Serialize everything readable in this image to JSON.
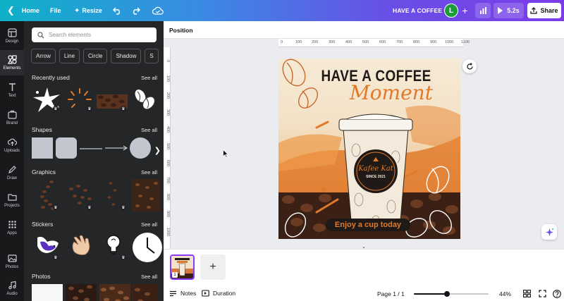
{
  "topbar": {
    "home_label": "Home",
    "file_label": "File",
    "resize_label": "Resize",
    "doc_title": "HAVE A COFFEE",
    "avatar_initial": "L",
    "play_label": "5.2s",
    "share_label": "Share"
  },
  "rail": {
    "items": [
      {
        "label": "Design",
        "icon": "design-icon"
      },
      {
        "label": "Elements",
        "icon": "elements-icon"
      },
      {
        "label": "Text",
        "icon": "text-icon"
      },
      {
        "label": "Brand",
        "icon": "brand-icon"
      },
      {
        "label": "Uploads",
        "icon": "upload-icon"
      },
      {
        "label": "Draw",
        "icon": "draw-icon"
      },
      {
        "label": "Projects",
        "icon": "folder-icon"
      },
      {
        "label": "Apps",
        "icon": "apps-icon"
      },
      {
        "label": "Photos",
        "icon": "photos-icon"
      },
      {
        "label": "Audio",
        "icon": "audio-icon"
      }
    ]
  },
  "panel": {
    "search_placeholder": "Search elements",
    "chips": [
      "Arrow",
      "Line",
      "Circle",
      "Shadow",
      "S"
    ],
    "see_all": "See all",
    "sections": {
      "recent": "Recently used",
      "shapes": "Shapes",
      "graphics": "Graphics",
      "stickers": "Stickers",
      "photos": "Photos"
    }
  },
  "context": {
    "position_label": "Position"
  },
  "ruler": {
    "h_ticks": [
      "0",
      "100",
      "200",
      "300",
      "400",
      "500",
      "600",
      "700",
      "800",
      "900",
      "1000",
      "1100"
    ],
    "v_ticks": [
      "0",
      "100",
      "200",
      "300",
      "400",
      "500",
      "600",
      "700",
      "800",
      "900",
      "1000"
    ]
  },
  "design": {
    "headline": "HAVE A COFFEE",
    "script_text": "Moment",
    "cup_brand": "Kafee Kat",
    "cup_since": "SINCE 2021",
    "cta": "Enjoy a cup today",
    "colors": {
      "accent": "#e07a2a",
      "dark": "#1f1a17",
      "cream": "#f6ead6"
    }
  },
  "pages": {
    "thumb_number": "1"
  },
  "bottombar": {
    "notes_label": "Notes",
    "duration_label": "Duration",
    "page_indicator": "Page 1 / 1",
    "zoom_label": "44%",
    "zoom_value": 0.44
  }
}
